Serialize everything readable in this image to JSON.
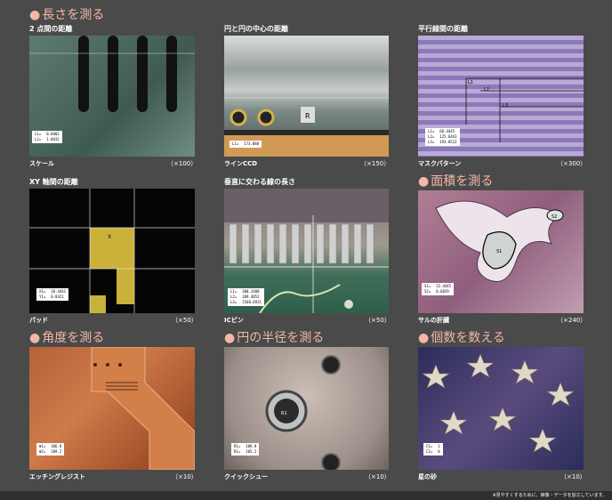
{
  "headings": {
    "length": "長さを測る",
    "area": "面積を測る",
    "angle": "角度を測る",
    "radius": "円の半径を測る",
    "count": "個数を数える"
  },
  "panels": [
    {
      "label": "2 点間の距離",
      "caption": "スケール",
      "mag": "（×100）",
      "readouts": [
        [
          "L1=",
          "0.6002"
        ],
        [
          "L2=",
          "1.0832"
        ]
      ]
    },
    {
      "label": "円と円の中心の距離",
      "caption": "ラインCCD",
      "mag": "（×150）",
      "readouts": [
        [
          "L1=",
          "173.888"
        ]
      ]
    },
    {
      "label": "平行線間の距離",
      "caption": "マスクパターン",
      "mag": "（×300）",
      "readouts": [
        [
          "L1=",
          "60.4445"
        ],
        [
          "L2=",
          "125.6443"
        ],
        [
          "L3=",
          "193.0522"
        ]
      ]
    },
    {
      "label": "XY 軸間の距離",
      "caption": "パッド",
      "mag": "（×50）",
      "readouts": [
        [
          "X1=",
          "10.4441"
        ],
        [
          "Y1=",
          "0.8421"
        ]
      ]
    },
    {
      "label": "垂直に交わる線の長さ",
      "caption": "ICピン",
      "mag": "（×50）",
      "readouts": [
        [
          "L1=",
          "300.2408"
        ],
        [
          "L2=",
          "289.4852"
        ],
        [
          "L3=",
          "1560.6921"
        ]
      ]
    },
    {
      "label": "",
      "caption": "サルの肝臓",
      "mag": "（×240）",
      "readouts": [
        [
          "S1=",
          "22.4445"
        ],
        [
          "S2=",
          "0.6829"
        ]
      ]
    },
    {
      "label": "",
      "caption": "エッチングレジスト",
      "mag": "（×10）",
      "readouts": [
        [
          "θ1=",
          "106.8"
        ],
        [
          "θ2=",
          "109.2"
        ]
      ]
    },
    {
      "label": "",
      "caption": "クイックシュー",
      "mag": "（×10）",
      "readouts": [
        [
          "R1=",
          "108.8"
        ],
        [
          "R2=",
          "105.2"
        ]
      ]
    },
    {
      "label": "",
      "caption": "星の砂",
      "mag": "（×10）",
      "readouts": [
        [
          "C1=",
          "1"
        ],
        [
          "C2=",
          "8"
        ]
      ]
    }
  ],
  "image_marks": {
    "ccd_tag": "R",
    "mask_l1": "L1",
    "mask_l2": "L2",
    "mask_l3": "L3",
    "pad_marker": "X",
    "liver_s1": "S1",
    "liver_s2": "S2",
    "shoe_r1": "R1"
  },
  "footer_note": "※見やすくするために、映像・データを加工しています。",
  "colors": {
    "background": "#4a4a4a",
    "heading": "#f2b7a7"
  }
}
